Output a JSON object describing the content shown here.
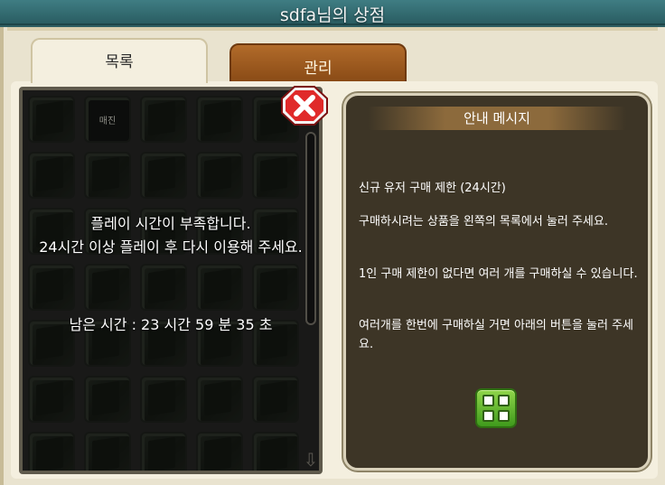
{
  "window": {
    "title": "sdfa님의 상점"
  },
  "tabs": [
    {
      "label": "목록",
      "active": true
    },
    {
      "label": "관리",
      "active": false
    }
  ],
  "grid": {
    "sold_label": "매진",
    "overlay": {
      "line1": "플레이 시간이 부족합니다.",
      "line2": "24시간 이상 플레이 후 다시 이용해 주세요.",
      "timer": "남은 시간 : 23 시간 59 분 35 초"
    }
  },
  "info": {
    "header": "안내 메시지",
    "paragraphs": [
      "신규 유저 구매 제한 (24시간)",
      "구매하시려는 상품을 왼쪽의 목록에서 눌러 주세요.",
      "1인 구매 제한이 없다면 여러 개를 구매하실 수 있습니다.",
      "여러개를 한번에 구매하실 거면 아래의 버튼을 눌러 주세요."
    ]
  },
  "icons": {
    "close": "close-x-icon",
    "buy": "multi-buy-icon",
    "scroll": "scroll-down-arrow-icon"
  },
  "colors": {
    "accent": "#2f5f63",
    "panel": "#3d3526",
    "buy": "#5cb82b",
    "close": "#e02a2a"
  }
}
